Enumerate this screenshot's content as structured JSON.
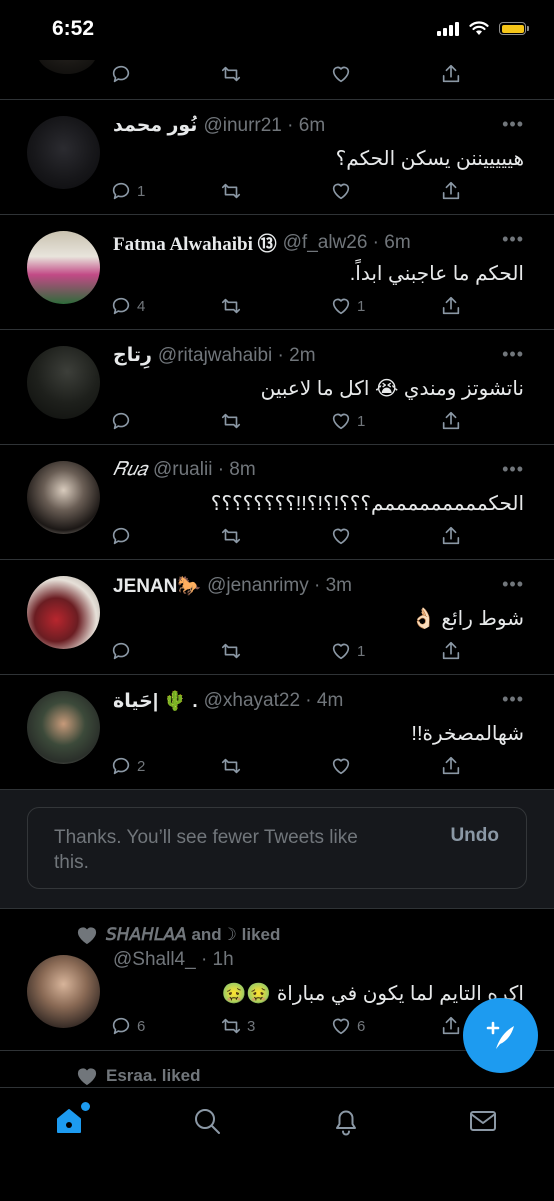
{
  "status": {
    "time": "6:52"
  },
  "tweets": [
    {
      "name": "نُور محمد",
      "handle": "@inurr21 · 6m",
      "text": "هيييييننن يسكن الحكم؟",
      "replies": "1",
      "retweets": "",
      "likes": ""
    },
    {
      "name": "Fatma Alwahaibi ⑬",
      "handle": "@f_alw26 · 6m",
      "text": "الحكم ما عاجبني ابداً.",
      "replies": "4",
      "retweets": "",
      "likes": "1"
    },
    {
      "name": "رِتاج",
      "handle": "@ritajwahaibi · 2m",
      "text": "ناتشوتز ومندي 😭 اكل ما لاعبين",
      "replies": "",
      "retweets": "",
      "likes": "1"
    },
    {
      "name": "𝑅𝑢𝑎",
      "handle": "@rualii · 8m",
      "text": "الحكمممممممممم؟؟؟!؟!؟!!؟؟؟؟؟؟؟؟",
      "replies": "",
      "retweets": "",
      "likes": ""
    },
    {
      "name": "JENAN🐎",
      "handle": "@jenanrimy · 3m",
      "text": "شوط رائع 👌🏻",
      "replies": "",
      "retweets": "",
      "likes": "1"
    },
    {
      "name": "حَياة| 🌵 .",
      "handle": "@xhayat22 · 4m",
      "text": "شهالمصخرة!!",
      "replies": "2",
      "retweets": "",
      "likes": ""
    }
  ],
  "notice": {
    "text": "Thanks. You’ll see fewer Tweets like this.",
    "undo": "Undo"
  },
  "liked_tweet": {
    "liked_by": "𝘚𝘏𝘈𝘏𝘓𝘈𝘈 and☽ liked",
    "handle": "@Shall4_ · 1h",
    "text": "اكره التايم لما يكون في مباراة 🤢🤢",
    "replies": "6",
    "retweets": "3",
    "likes": "6"
  },
  "liked_partial": {
    "liked_by": "Esraa. liked"
  },
  "icons": {
    "reply": "reply-icon",
    "retweet": "retweet-icon",
    "like": "heart-icon",
    "share": "share-icon",
    "fab": "compose-tweet-icon",
    "home": "home-icon",
    "search": "search-icon",
    "notifications": "bell-icon",
    "messages": "mail-icon"
  },
  "colors": {
    "accent": "#1d9bf0",
    "background": "#000000",
    "muted": "#71767b"
  }
}
